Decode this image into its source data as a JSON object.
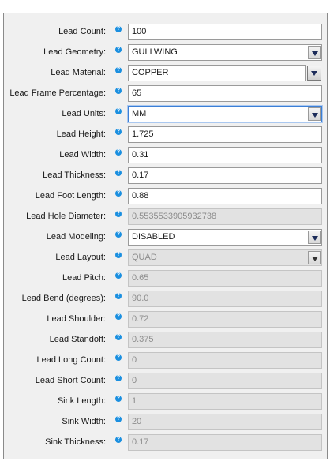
{
  "help_glyph": "?",
  "fields": [
    {
      "label": "Lead Count:",
      "value": "100",
      "kind": "text",
      "enabled": true
    },
    {
      "label": "Lead Geometry:",
      "value": "GULLWING",
      "kind": "select",
      "enabled": true
    },
    {
      "label": "Lead Material:",
      "value": "COPPER",
      "kind": "combo",
      "enabled": true
    },
    {
      "label": "Lead Frame Percentage:",
      "value": "65",
      "kind": "text",
      "enabled": true
    },
    {
      "label": "Lead Units:",
      "value": "MM",
      "kind": "select",
      "enabled": true,
      "focused": true
    },
    {
      "label": "Lead Height:",
      "value": "1.725",
      "kind": "text",
      "enabled": true
    },
    {
      "label": "Lead Width:",
      "value": "0.31",
      "kind": "text",
      "enabled": true
    },
    {
      "label": "Lead Thickness:",
      "value": "0.17",
      "kind": "text",
      "enabled": true
    },
    {
      "label": "Lead Foot Length:",
      "value": "0.88",
      "kind": "text",
      "enabled": true
    },
    {
      "label": "Lead Hole Diameter:",
      "value": "0.5535533905932738",
      "kind": "text",
      "enabled": false
    },
    {
      "label": "Lead Modeling:",
      "value": "DISABLED",
      "kind": "select",
      "enabled": true
    },
    {
      "label": "Lead Layout:",
      "value": "QUAD",
      "kind": "select",
      "enabled": false
    },
    {
      "label": "Lead Pitch:",
      "value": "0.65",
      "kind": "text",
      "enabled": false
    },
    {
      "label": "Lead Bend (degrees):",
      "value": "90.0",
      "kind": "text",
      "enabled": false
    },
    {
      "label": "Lead Shoulder:",
      "value": "0.72",
      "kind": "text",
      "enabled": false
    },
    {
      "label": "Lead Standoff:",
      "value": "0.375",
      "kind": "text",
      "enabled": false
    },
    {
      "label": "Lead Long Count:",
      "value": "0",
      "kind": "text",
      "enabled": false
    },
    {
      "label": "Lead Short Count:",
      "value": "0",
      "kind": "text",
      "enabled": false
    },
    {
      "label": "Sink Length:",
      "value": "1",
      "kind": "text",
      "enabled": false
    },
    {
      "label": "Sink Width:",
      "value": "20",
      "kind": "text",
      "enabled": false
    },
    {
      "label": "Sink Thickness:",
      "value": "0.17",
      "kind": "text",
      "enabled": false
    }
  ]
}
